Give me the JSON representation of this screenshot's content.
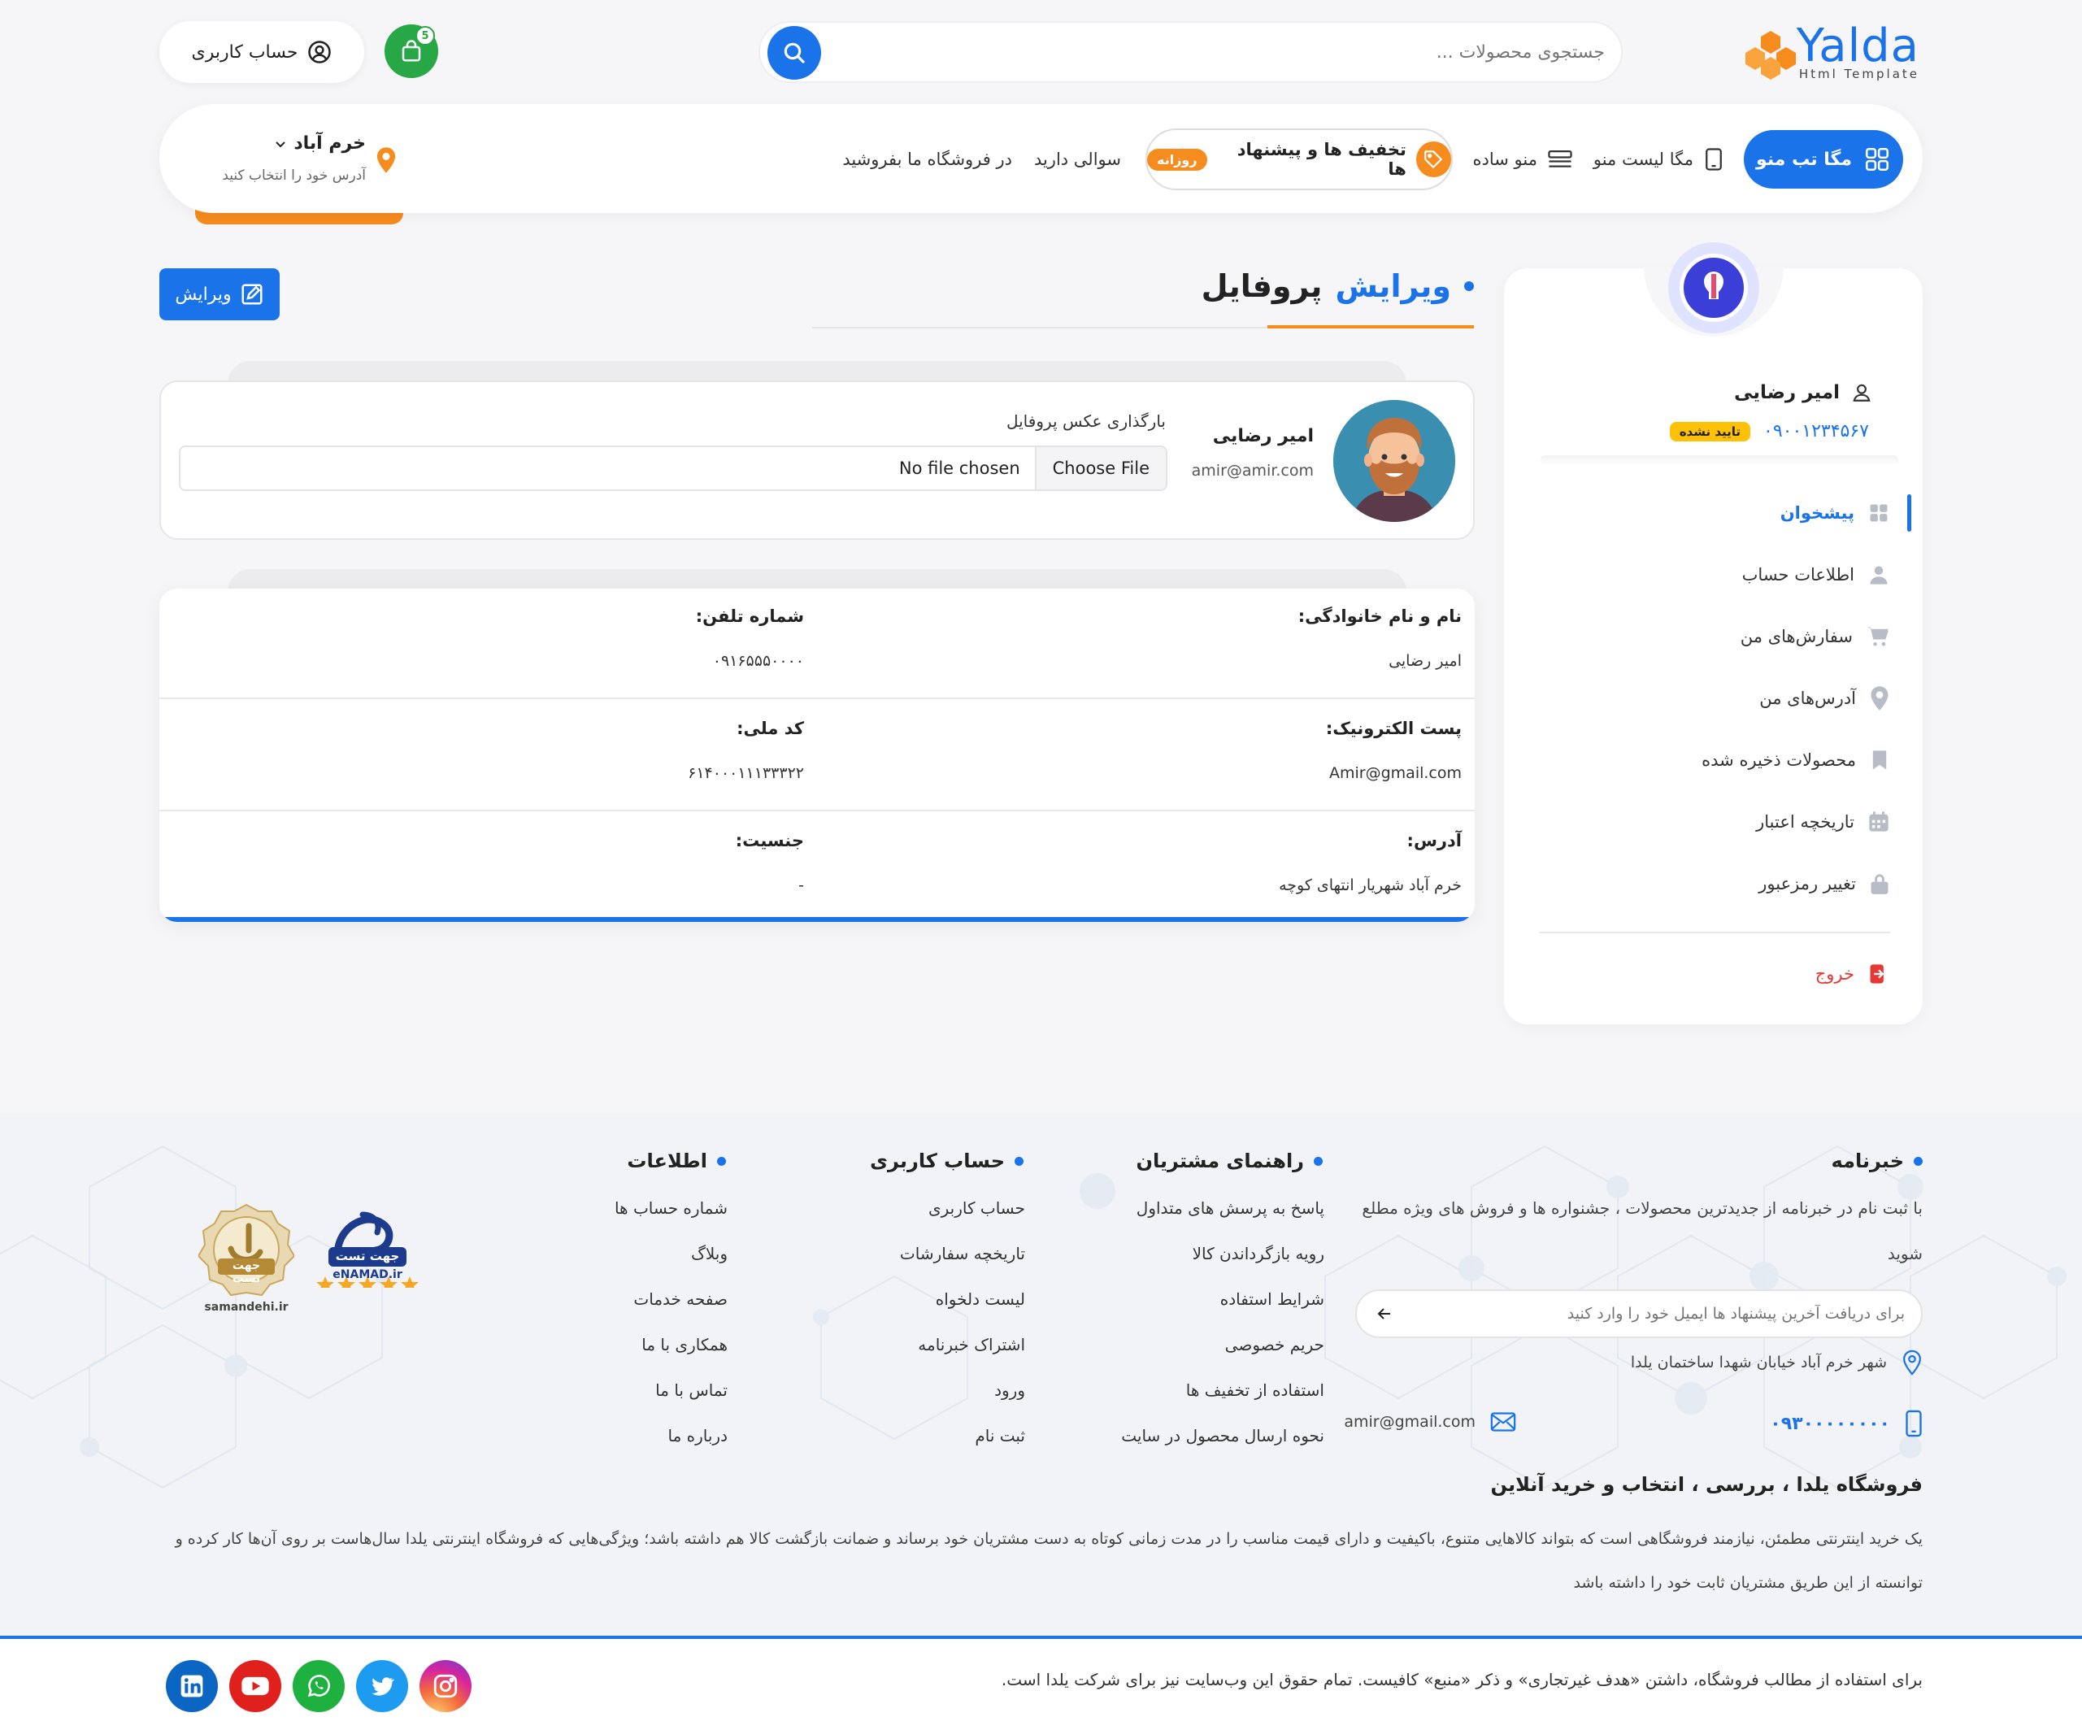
{
  "header": {
    "logo_text": "Yalda",
    "logo_sub": "Html Template",
    "search_placeholder": "جستجوی محصولات ...",
    "cart_count": "5",
    "account_label": "حساب کاربری"
  },
  "nav": {
    "mega_tab": "مگا تب منو",
    "mega_list": "مگا لیست منو",
    "simple_menu": "منو ساده",
    "offers": "تخفیف ها و پیشنهاد ها",
    "offers_badge": "روزانه",
    "question": "سوالی دارید",
    "sell": "در فروشگاه ما بفروشید",
    "location_city": "خرم آباد",
    "location_sub": "آدرس خود را انتخاب کنید"
  },
  "sidebar": {
    "user_name": "امیر رضایی",
    "phone": "۰۹۰۰۱۲۳۴۵۶۷",
    "status": "تایید نشده",
    "items": [
      {
        "label": "پیشخوان"
      },
      {
        "label": "اطلاعات حساب"
      },
      {
        "label": "سفارش‌های من"
      },
      {
        "label": "آدرس‌های من"
      },
      {
        "label": "محصولات ذخیره شده"
      },
      {
        "label": "تاریخچه اعتبار"
      },
      {
        "label": "تغییر رمزعبور"
      }
    ],
    "logout": "خروج"
  },
  "main": {
    "title_blue": "ویرایش",
    "title_rest": "پروفایل",
    "edit_button": "ویرایش",
    "profile": {
      "name": "امیر رضایی",
      "email": "amir@amir.com",
      "upload_label": "بارگذاری عکس پروفایل",
      "file_button": "Choose File",
      "file_status": "No file chosen"
    },
    "info": {
      "full_name_label": "نام و نام خانوادگی:",
      "full_name_value": "امیر رضایی",
      "phone_label": "شماره تلفن:",
      "phone_value": "۰۹۱۶۵۵۵۰۰۰۰",
      "email_label": "پست الکترونیک:",
      "email_value": "Amir@gmail.com",
      "national_label": "کد ملی:",
      "national_value": "۶۱۴۰۰۰۱۱۱۳۳۳۲۲",
      "address_label": "آدرس:",
      "address_value": "خرم آباد شهریار انتهای کوچه",
      "gender_label": "جنسیت:",
      "gender_value": "-"
    }
  },
  "footer": {
    "newsletter_title": "خبرنامه",
    "newsletter_text": "با ثبت نام در خبرنامه از جدیدترین محصولات ، جشنواره ها و فروش های ویژه مطلع شوید",
    "newsletter_placeholder": "برای دریافت آخرین پیشنهاد ها ایمیل خود را وارد کنید",
    "address": "شهر خرم آباد خیابان شهدا ساختمان یلدا",
    "phone": "۰۹۳۰۰۰۰۰۰۰۰",
    "email": "amir@gmail.com",
    "guide_title": "راهنمای مشتریان",
    "guide_links": [
      "پاسخ به پرسش های متداول",
      "رویه بازگرداندن کالا",
      "شرایط استفاده",
      "حریم خصوصی",
      "استفاده از تخفیف ها",
      "نحوه ارسال محصول در سایت"
    ],
    "account_title": "حساب کاربری",
    "account_links": [
      "حساب کاربری",
      "تاریخچه سفارشات",
      "لیست دلخواه",
      "اشتراک خبرنامه",
      "ورود",
      "ثبت نام"
    ],
    "info_title": "اطلاعات",
    "info_links": [
      "شماره حساب ها",
      "وبلاگ",
      "صفحه خدمات",
      "همکاری با ما",
      "تماس با ما",
      "درباره ما"
    ],
    "badge_enamad": "eNAMAD.ir",
    "badge_enamad_top": "جهت تست",
    "badge_samandehi": "samandehi.ir",
    "badge_samandehi_top": "جهت تست",
    "about_title": "فروشگاه یلدا ، بررسی ، انتخاب و خرید آنلاین",
    "about_text": "یک خرید اینترنتی مطمئن، نیازمند فروشگاهی است که بتواند کالاهایی متنوع، باکیفیت و دارای قیمت مناسب را در مدت زمانی کوتاه به دست مشتریان خود برساند و ضمانت بازگشت کالا هم داشته باشد؛ ویژگی‌هایی که فروشگاه اینترنتی یلدا سال‌هاست بر روی آن‌ها کار کرده و توانسته از این طریق مشتریان ثابت خود را داشته باشد",
    "copyright": "برای استفاده از مطالب فروشگاه، داشتن «هدف غیرتجاری» و ذکر «منبع» کافیست. تمام حقوق این وب‌سایت نیز برای شرکت یلدا است."
  },
  "colors": {
    "primary": "#1a73e8",
    "accent": "#f68b1e",
    "success": "#27a745",
    "danger": "#e53935"
  }
}
